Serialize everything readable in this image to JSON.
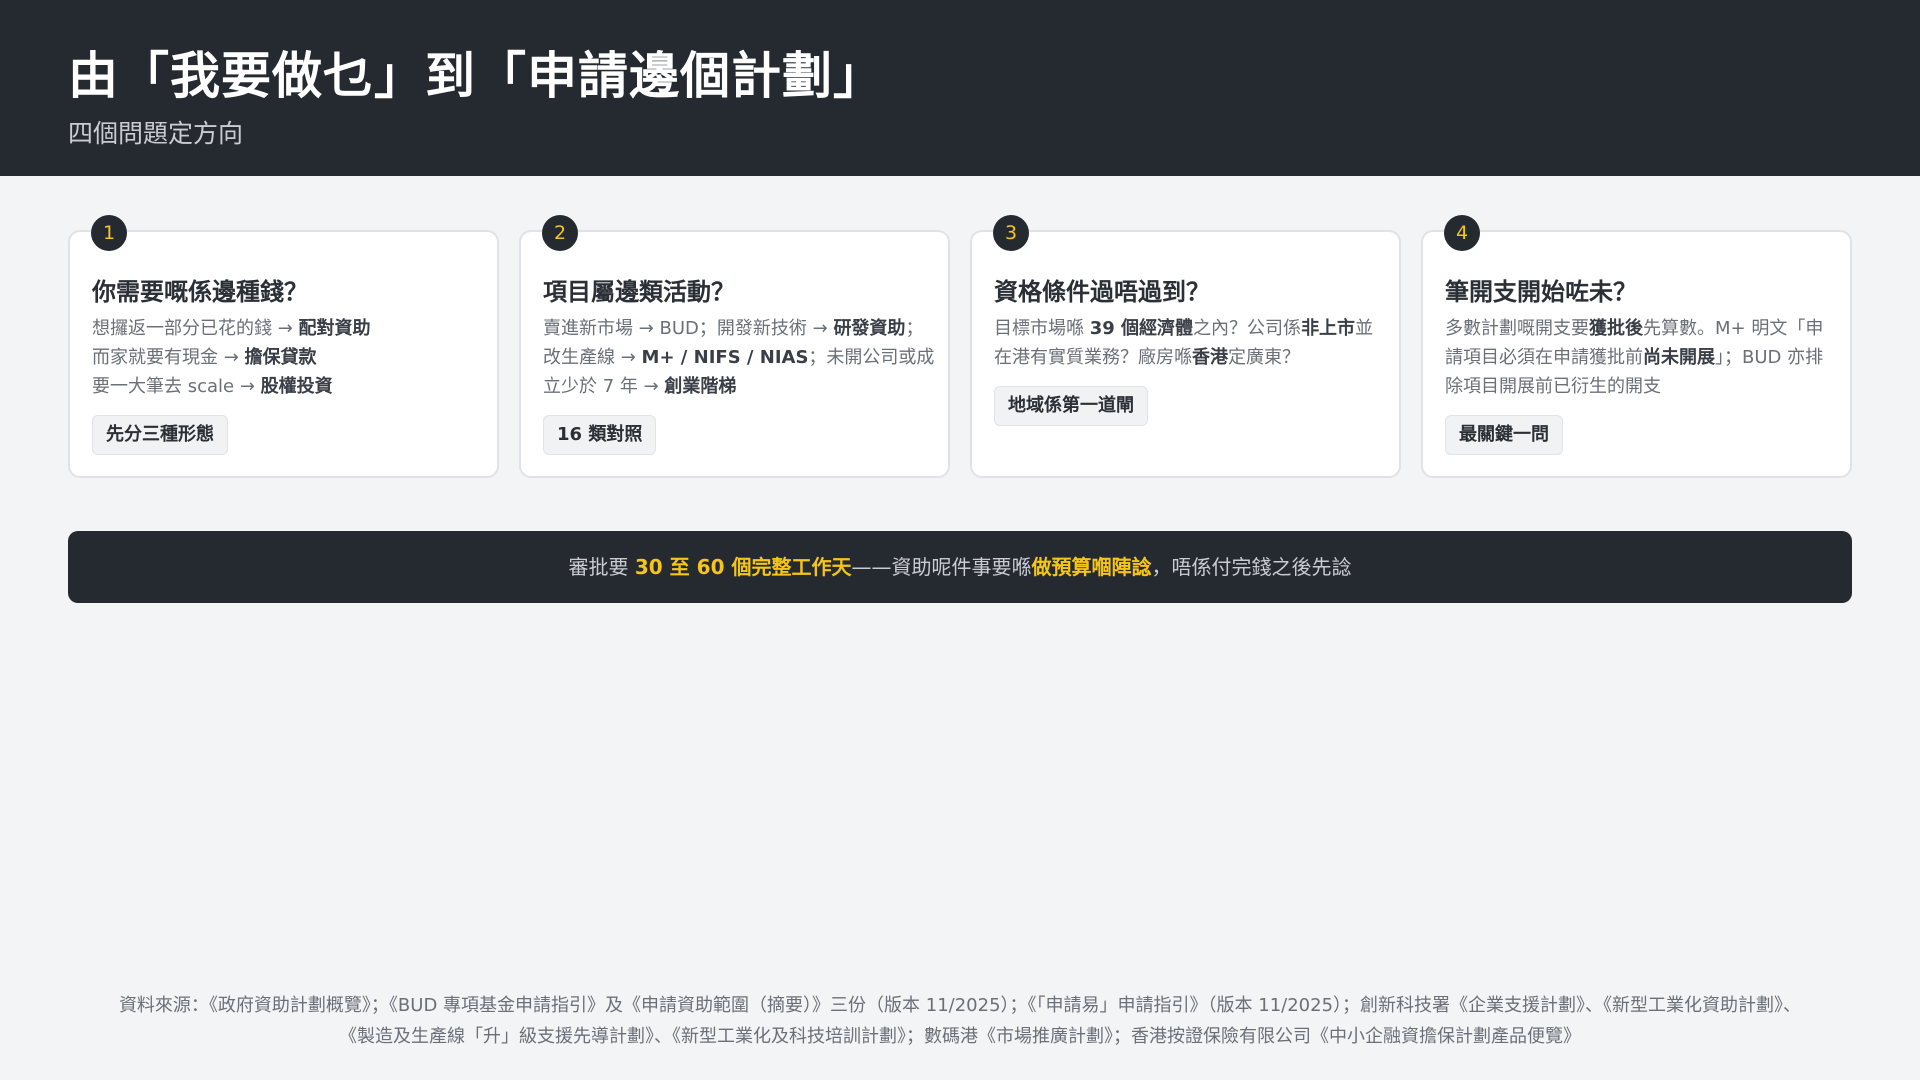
{
  "header": {
    "title": "由「我要做乜」到「申請邊個計劃」",
    "subtitle": "四個問題定方向"
  },
  "cards": [
    {
      "number": "1",
      "title": "你需要嘅係邊種錢？",
      "lines": [
        {
          "text": "想攞返一部分已花的錢 → ",
          "bold": "配對資助"
        },
        {
          "text": "而家就要有現金 → ",
          "bold": "擔保貸款"
        },
        {
          "text": "要一大筆去 scale → ",
          "bold": "股權投資"
        }
      ],
      "tag": "先分三種形態"
    },
    {
      "number": "2",
      "title": "項目屬邊類活動？",
      "segments": [
        {
          "text": "賣進新市場 → BUD；開發新技術 → "
        },
        {
          "text": "研發資助",
          "bold": true
        },
        {
          "text": "；改生產線 → "
        },
        {
          "text": "M+ / NIFS / NIAS",
          "bold": true
        },
        {
          "text": "；未開公司或成立少於 7 年 → "
        },
        {
          "text": "創業階梯",
          "bold": true
        }
      ],
      "tag": "16 類對照"
    },
    {
      "number": "3",
      "title": "資格條件過唔過到？",
      "segments": [
        {
          "text": "目標市場喺 "
        },
        {
          "text": "39 個經濟體",
          "bold": true
        },
        {
          "text": "之內？公司係"
        },
        {
          "text": "非上市",
          "bold": true
        },
        {
          "text": "並在港有實質業務？廠房喺"
        },
        {
          "text": "香港",
          "bold": true
        },
        {
          "text": "定廣東？"
        }
      ],
      "tag": "地域係第一道閘"
    },
    {
      "number": "4",
      "title": "筆開支開始咗未？",
      "segments": [
        {
          "text": "多數計劃嘅開支要"
        },
        {
          "text": "獲批後",
          "bold": true
        },
        {
          "text": "先算數。M+ 明文「申請項目必須在申請獲批前"
        },
        {
          "text": "尚未開展",
          "bold": true
        },
        {
          "text": "」；BUD 亦排除項目開展前已衍生的開支"
        }
      ],
      "tag": "最關鍵一問"
    }
  ],
  "banner": {
    "prefix": "審批要 ",
    "highlight1": "30 至 60 個完整工作天",
    "middle": "——資助呢件事要喺",
    "highlight2": "做預算嗰陣諗",
    "suffix": "，唔係付完錢之後先諗"
  },
  "footer": {
    "line1": "資料來源：《政府資助計劃概覽》；《BUD 專項基金申請指引》及《申請資助範圍（摘要）》三份（版本 11/2025）；《「申請易」申請指引》（版本 11/2025）；創新科技署《企業支援計劃》、《新型工業化資助計劃》、",
    "line2": "《製造及生產線「升」級支援先導計劃》、《新型工業化及科技培訓計劃》；數碼港《市場推廣計劃》；香港按證保險有限公司《中小企融資擔保計劃產品便覽》"
  },
  "colors": {
    "header_bg": "#252a31",
    "accent": "#f5c518",
    "page_bg": "#f3f4f6"
  }
}
